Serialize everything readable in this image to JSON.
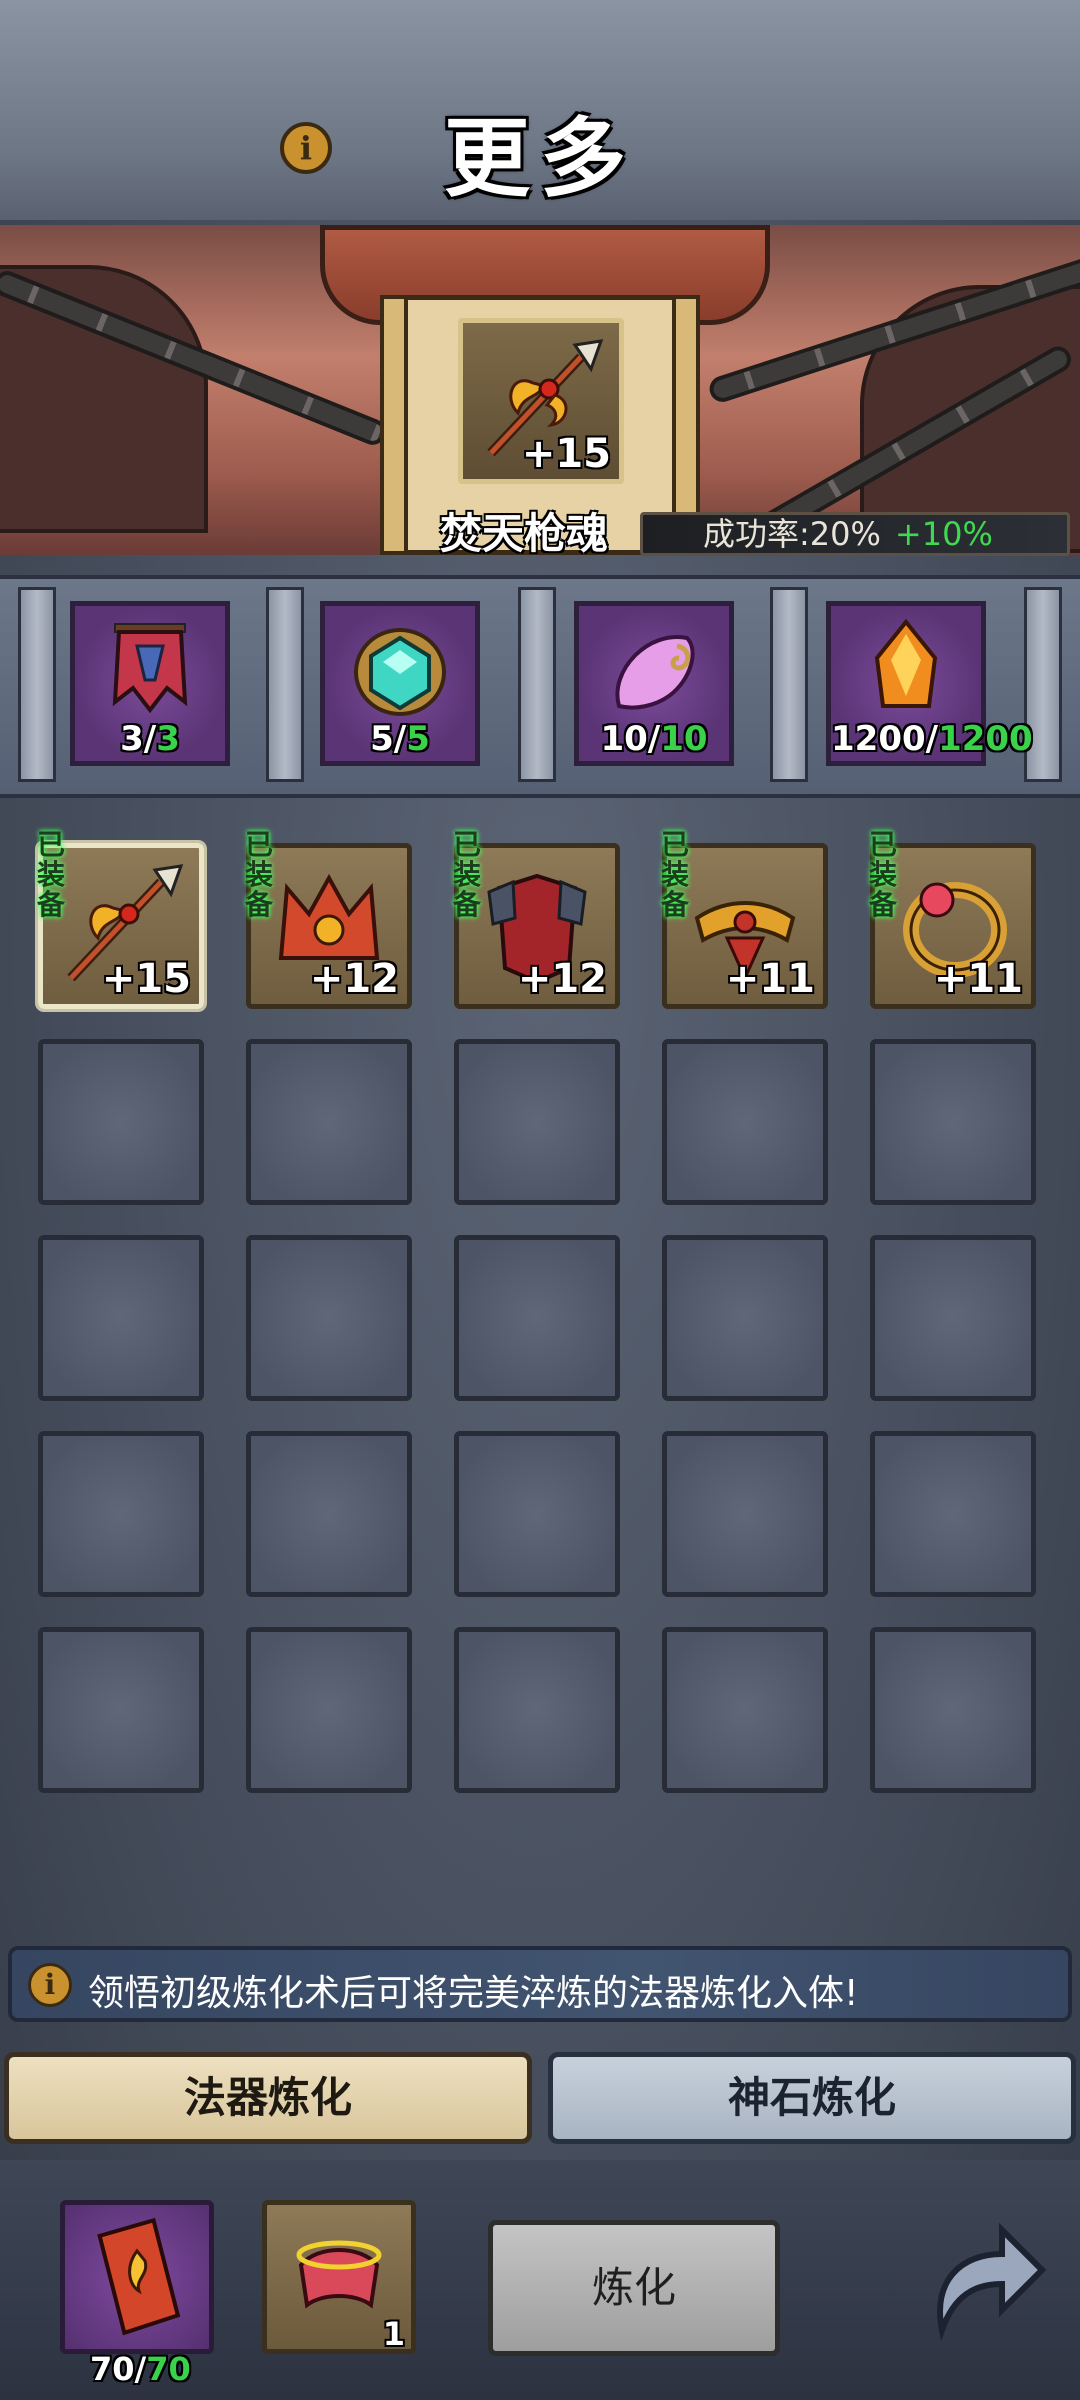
{
  "header": {
    "title": "更多",
    "info_icon": "i"
  },
  "featured": {
    "name": "焚天枪魂",
    "level": "+15",
    "icon": "spear-icon",
    "success_rate_label": "成功率:20%",
    "success_rate_bonus": "+10%"
  },
  "materials": [
    {
      "icon": "banner-scroll-icon",
      "have": "3",
      "need": "3"
    },
    {
      "icon": "teal-gem-icon",
      "have": "5",
      "need": "5"
    },
    {
      "icon": "pink-jade-icon",
      "have": "10",
      "need": "10"
    },
    {
      "icon": "fire-crystal-icon",
      "have": "1200",
      "need": "1200"
    }
  ],
  "inventory": {
    "items": [
      {
        "icon": "spear-icon",
        "level": "+15",
        "equipped_tag": "已装备",
        "selected": true
      },
      {
        "icon": "crown-icon",
        "level": "+12",
        "equipped_tag": "已装备"
      },
      {
        "icon": "armor-icon",
        "level": "+12",
        "equipped_tag": "已装备"
      },
      {
        "icon": "belt-icon",
        "level": "+11",
        "equipped_tag": "已装备"
      },
      {
        "icon": "ring-icon",
        "level": "+11",
        "equipped_tag": "已装备"
      }
    ],
    "empty_slots": 20
  },
  "tip": {
    "icon": "i",
    "text": "领悟初级炼化术后可将完美淬炼的法器炼化入体!"
  },
  "tabs": [
    {
      "label": "法器炼化",
      "active": true
    },
    {
      "label": "神石炼化",
      "active": false
    }
  ],
  "bottom": {
    "slot1": {
      "icon": "flame-scroll-icon",
      "count_have": "70",
      "count_need": "70"
    },
    "slot2": {
      "icon": "red-scroll-icon",
      "count": "1"
    },
    "refine_button": "炼化",
    "back_icon": "return-arrow-icon"
  },
  "colors": {
    "green": "#39d24a",
    "gold": "#c9922e",
    "purple": "#5a3475"
  }
}
